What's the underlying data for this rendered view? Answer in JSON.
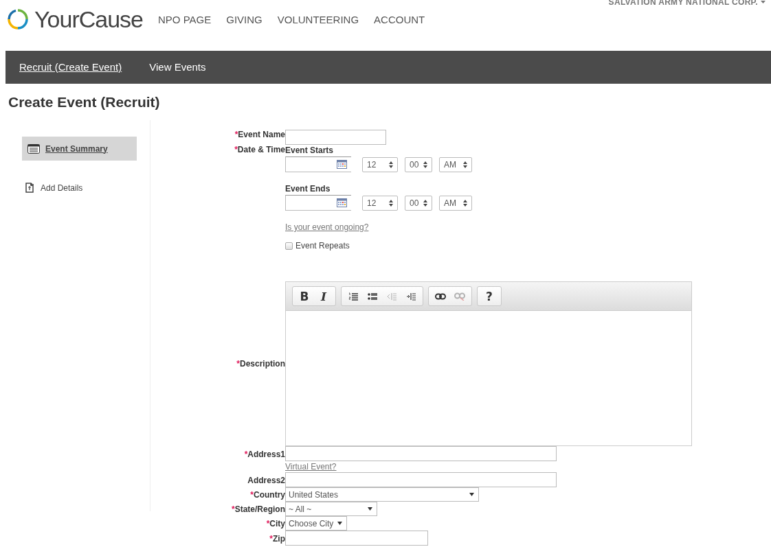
{
  "header": {
    "logo": "YourCause",
    "nav": [
      {
        "label": "NPO PAGE"
      },
      {
        "label": "GIVING"
      },
      {
        "label": "VOLUNTEERING"
      },
      {
        "label": "ACCOUNT"
      }
    ],
    "account": "SALVATION ARMY NATIONAL CORP."
  },
  "tabs": [
    {
      "label": "Recruit (Create Event)",
      "selected": true
    },
    {
      "label": "View Events",
      "selected": false
    }
  ],
  "page_title": "Create Event (Recruit)",
  "sidebar": {
    "items": [
      {
        "label": "Event Summary",
        "selected": true
      },
      {
        "label": "Add Details",
        "selected": false
      }
    ]
  },
  "form": {
    "required_mark": "*",
    "event_name": {
      "label": "Event Name",
      "required": true
    },
    "date_time": {
      "label": "Date & Time",
      "required": true,
      "starts": {
        "label": "Event Starts",
        "hour": "12",
        "minute": "00",
        "ampm": "AM"
      },
      "ends": {
        "label": "Event Ends",
        "hour": "12",
        "minute": "00",
        "ampm": "AM"
      }
    },
    "ongoing_link": "Is your event ongoing?",
    "repeats": {
      "label": "Event Repeats",
      "checked": false
    },
    "description": {
      "label": "Description",
      "required": true,
      "toolbar": [
        {
          "buttons": [
            {
              "kind": "bold",
              "label": "B",
              "disabled": false
            },
            {
              "kind": "italic",
              "label": "I",
              "disabled": false
            }
          ]
        },
        {
          "buttons": [
            {
              "kind": "ordered-list",
              "disabled": false
            },
            {
              "kind": "bullet-list",
              "disabled": false
            },
            {
              "kind": "outdent",
              "disabled": true
            },
            {
              "kind": "indent",
              "disabled": false
            }
          ]
        },
        {
          "buttons": [
            {
              "kind": "link",
              "disabled": false
            },
            {
              "kind": "unlink",
              "disabled": true
            }
          ]
        },
        {
          "buttons": [
            {
              "kind": "help",
              "label": "?",
              "disabled": false
            }
          ]
        }
      ]
    },
    "address_fields": [
      {
        "kind": "text",
        "label": "Address1",
        "required": true
      },
      {
        "kind": "link",
        "text": "Virtual Event?"
      },
      {
        "kind": "text",
        "label": "Address2",
        "required": false
      },
      {
        "kind": "select",
        "label": "Country",
        "required": true,
        "value": "United States"
      },
      {
        "kind": "select",
        "label": "State/Region",
        "required": true,
        "value": "~ All ~"
      },
      {
        "kind": "select",
        "label": "City",
        "required": true,
        "value": "Choose City"
      },
      {
        "kind": "text",
        "label": "Zip",
        "required": true
      }
    ]
  }
}
